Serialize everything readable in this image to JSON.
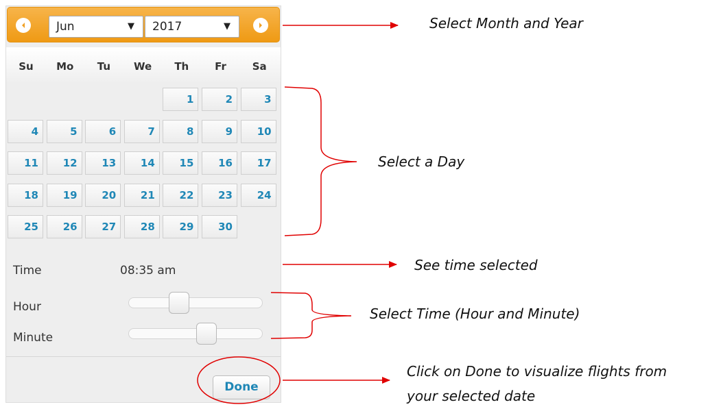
{
  "header": {
    "prev_icon": "chevron-left-icon",
    "next_icon": "chevron-right-icon",
    "month": "Jun",
    "year": "2017",
    "dropdown_arrow": "▼"
  },
  "weekdays": [
    "Su",
    "Mo",
    "Tu",
    "We",
    "Th",
    "Fr",
    "Sa"
  ],
  "days": {
    "first_weekday_index": 4,
    "list": [
      "1",
      "2",
      "3",
      "4",
      "5",
      "6",
      "7",
      "8",
      "9",
      "10",
      "11",
      "12",
      "13",
      "14",
      "15",
      "16",
      "17",
      "18",
      "19",
      "20",
      "21",
      "22",
      "23",
      "24",
      "25",
      "26",
      "27",
      "28",
      "29",
      "30"
    ]
  },
  "time": {
    "label": "Time",
    "value": "08:35 am",
    "hour_label": "Hour",
    "minute_label": "Minute",
    "hour_value": 8,
    "hour_max": 23,
    "minute_value": 35,
    "minute_max": 59
  },
  "done_label": "Done",
  "annotations": {
    "month_year": "Select Month and Year",
    "day": "Select a Day",
    "time_selected": "See time selected",
    "time_select": "Select Time (Hour and Minute)",
    "done_line1": "Click on Done to visualize flights from",
    "done_line2": "your selected date"
  },
  "colors": {
    "header": "#f0a024",
    "day_text": "#1f87b6",
    "annotation": "#e00000"
  }
}
